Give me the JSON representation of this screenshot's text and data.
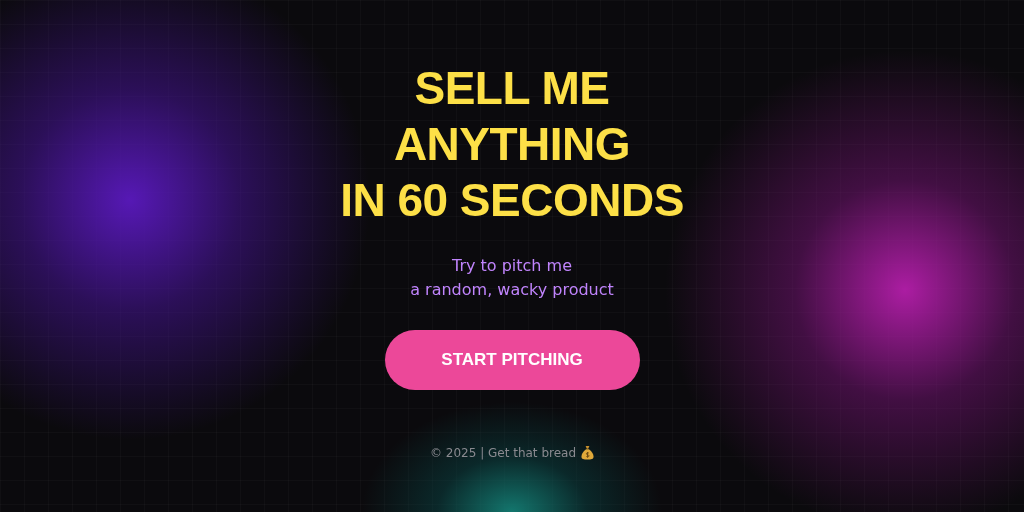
{
  "hero": {
    "title_lines": [
      "SELL ME",
      "ANYTHING",
      "IN 60 SECONDS"
    ],
    "subtitle_lines": [
      "Try to pitch me",
      "a random, wacky product"
    ],
    "button": "START PITCHING"
  },
  "footer": {
    "text": "© 2025 | Get that bread"
  }
}
